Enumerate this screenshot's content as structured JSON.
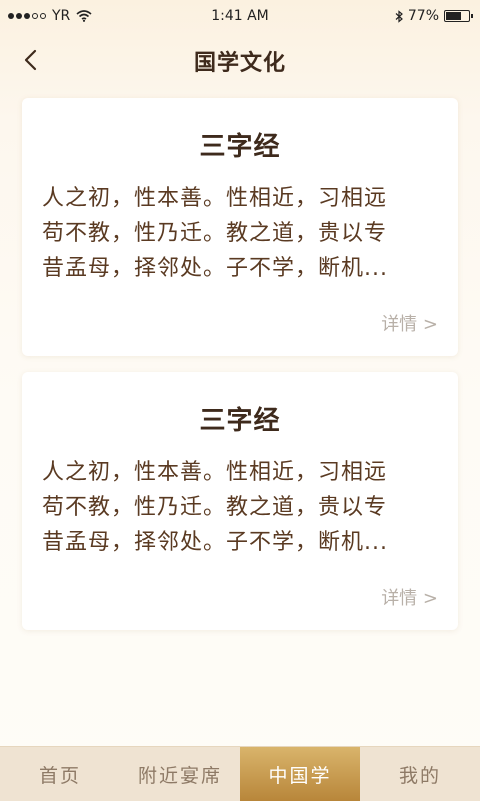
{
  "status": {
    "carrier": "YR",
    "time": "1:41 AM",
    "battery": "77%",
    "battery_level": 0.77,
    "icons": [
      "signal-dots-icon",
      "wifi-icon",
      "bluetooth-icon",
      "battery-icon"
    ]
  },
  "nav": {
    "title": "国学文化",
    "back_icon": "chevron-left-icon"
  },
  "cards": [
    {
      "title": "三字经",
      "lines": [
        "人之初，性本善。性相近，习相远",
        "苟不教，性乃迁。教之道，贵以专",
        "昔孟母，择邻处。子不学，断机..."
      ],
      "more": "详情 >"
    },
    {
      "title": "三字经",
      "lines": [
        "人之初，性本善。性相近，习相远",
        "苟不教，性乃迁。教之道，贵以专",
        "昔孟母，择邻处。子不学，断机..."
      ],
      "more": "详情 >"
    }
  ],
  "tabs": [
    {
      "label": "首页",
      "active": false
    },
    {
      "label": "附近宴席",
      "active": false
    },
    {
      "label": "中国学",
      "active": true
    },
    {
      "label": "我的",
      "active": false
    }
  ],
  "colors": {
    "accent": "#c99a4e",
    "title_text": "#3e2a1c",
    "body_text": "#5a3a22",
    "tab_bg": "#efe3d2"
  }
}
